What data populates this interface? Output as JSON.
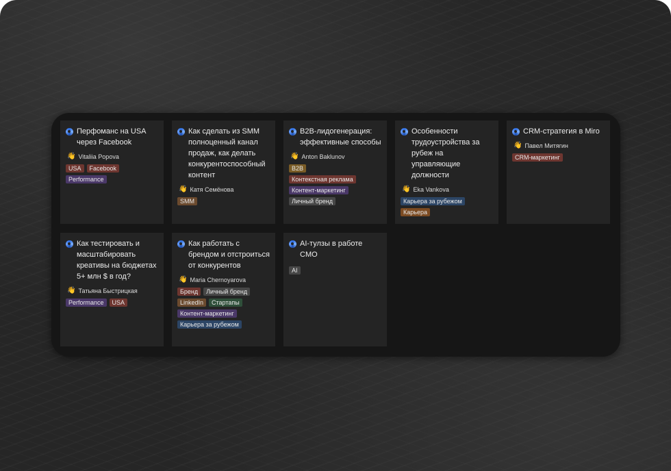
{
  "cards": [
    {
      "title": "Перфоманс на USA через Facebook",
      "author": "Vitaliia Popova",
      "tags": [
        {
          "label": "USA",
          "color": "red"
        },
        {
          "label": "Facebook",
          "color": "red"
        },
        {
          "label": "Performance",
          "color": "purple"
        }
      ]
    },
    {
      "title": "Как сделать из SMM полноценный канал продаж, как делать конкурентоспособный контент",
      "author": "Катя Семёнова",
      "tags": [
        {
          "label": "SMM",
          "color": "brown"
        }
      ]
    },
    {
      "title": "B2B-лидогенерация: эффективные способы",
      "author": "Anton Baklunov",
      "tags": [
        {
          "label": "B2B",
          "color": "gold"
        },
        {
          "label": "Контекстная реклама",
          "color": "red"
        },
        {
          "label": "Контент-маркетинг",
          "color": "purple"
        },
        {
          "label": "Личный бренд",
          "color": "gray"
        }
      ]
    },
    {
      "title": "Особенности трудоустройства за рубеж на управляющие должности",
      "author": "Eka Vankova",
      "tags": [
        {
          "label": "Карьера за рубежом",
          "color": "blue"
        },
        {
          "label": "Карьера",
          "color": "orange"
        }
      ]
    },
    {
      "title": "CRM-стратегия в Miro",
      "author": "Павел Митягин",
      "tags": [
        {
          "label": "CRM-маркетинг",
          "color": "red"
        }
      ]
    },
    {
      "title": "Как тестировать и масштабировать креативы на бюджетах 5+ млн $ в год?",
      "author": "Татьяна Быстрицкая",
      "tags": [
        {
          "label": "Performance",
          "color": "purple"
        },
        {
          "label": "USA",
          "color": "red"
        }
      ]
    },
    {
      "title": "Как работать с брендом и отстроиться от конкурентов",
      "author": "Maria Chernoyarova",
      "tags": [
        {
          "label": "Бренд",
          "color": "red"
        },
        {
          "label": "Личный бренд",
          "color": "gray"
        },
        {
          "label": "LinkedIn",
          "color": "brown"
        },
        {
          "label": "Стартапы",
          "color": "green"
        },
        {
          "label": "Контент-маркетинг",
          "color": "purple"
        },
        {
          "label": "Карьера за рубежом",
          "color": "blue"
        }
      ]
    },
    {
      "title": "AI-тулзы в работе CMO",
      "author": "",
      "tags": [
        {
          "label": "AI",
          "color": "gray"
        }
      ]
    }
  ]
}
